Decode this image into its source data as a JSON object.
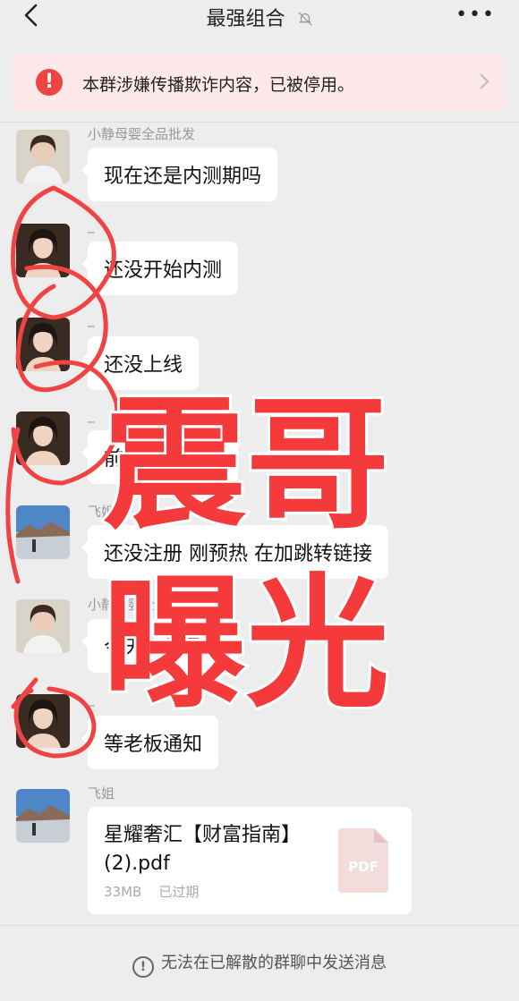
{
  "header": {
    "title": "最强组合",
    "more": "•••"
  },
  "alert": {
    "text": "本群涉嫌传播欺诈内容，已被停用。"
  },
  "messages": [
    {
      "sender": "小静母婴全品批发",
      "text": "现在还是内测期吗"
    },
    {
      "sender": "_",
      "text": "还没开始内测"
    },
    {
      "sender": "_",
      "text": "还没上线"
    },
    {
      "sender": "_",
      "text": "前期中的前期"
    },
    {
      "sender": "飞姐",
      "text": "还没注册 刚预热 在加跳转链接"
    },
    {
      "sender": "小静母婴全品批发",
      "text": "今天上线是吧"
    },
    {
      "sender": "_",
      "text": "等老板通知"
    }
  ],
  "file_message": {
    "sender": "飞姐",
    "file_name": "星耀奢汇【财富指南】(2).pdf",
    "size": "33MB",
    "status": "已过期",
    "badge": "PDF"
  },
  "footer": {
    "text": "无法在已解散的群聊中发送消息"
  },
  "overlay": {
    "line1": "震哥",
    "line2": "曝光"
  },
  "colors": {
    "accent_red": "#f43a3a",
    "alert_bg": "#fde9e9",
    "bg": "#ededed"
  }
}
